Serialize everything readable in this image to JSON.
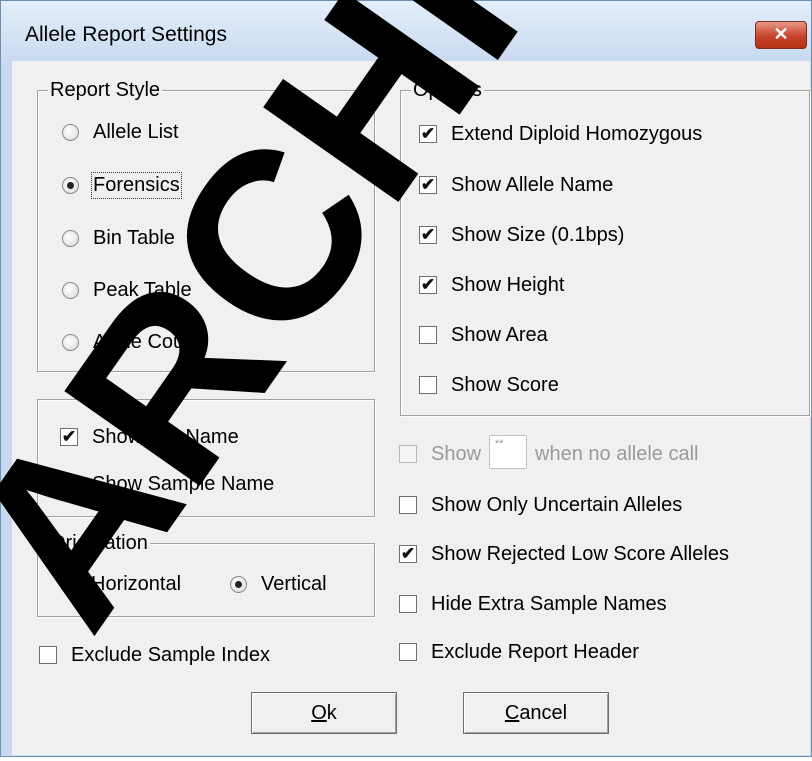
{
  "title": "Allele Report Settings",
  "close_glyph": "✕",
  "report_style": {
    "legend": "Report Style",
    "options": [
      {
        "label": "Allele List",
        "selected": false
      },
      {
        "label": "Forensics",
        "selected": true
      },
      {
        "label": "Bin Table",
        "selected": false
      },
      {
        "label": "Peak Table",
        "selected": false
      },
      {
        "label": "Allele Count",
        "selected": false
      }
    ]
  },
  "options_group": {
    "legend": "Options",
    "items": [
      {
        "label": "Extend Diploid Homozygous",
        "checked": true
      },
      {
        "label": "Show Allele Name",
        "checked": true
      },
      {
        "label": "Show Size (0.1bps)",
        "checked": true
      },
      {
        "label": "Show Height",
        "checked": true
      },
      {
        "label": "Show Area",
        "checked": false
      },
      {
        "label": "Show Score",
        "checked": false
      }
    ]
  },
  "names_group": {
    "items": [
      {
        "label": "Show File Name",
        "checked": true
      },
      {
        "label": "Show Sample Name",
        "checked": false
      }
    ]
  },
  "orientation": {
    "legend": "Orientation",
    "horizontal": "Horizontal",
    "vertical": "Vertical",
    "selected": "Vertical"
  },
  "exclude_sample_index": {
    "label": "Exclude Sample Index",
    "checked": false
  },
  "no_call": {
    "show_label": "Show",
    "placeholder_value": "**",
    "suffix": "when no allele call",
    "enabled": false,
    "checked": false
  },
  "right_checks": [
    {
      "label": "Show Only Uncertain Alleles",
      "checked": false
    },
    {
      "label": "Show Rejected Low Score Alleles",
      "checked": true
    },
    {
      "label": "Hide Extra Sample Names",
      "checked": false
    },
    {
      "label": "Exclude Report Header",
      "checked": false
    }
  ],
  "buttons": {
    "ok_mnemonic": "O",
    "ok_rest": "k",
    "cancel_mnemonic": "C",
    "cancel_rest": "ancel"
  },
  "watermark": "ARCHIVE",
  "colors": {
    "watermark": "#000000",
    "title_bar": "#c9daf0",
    "close_button": "#c7432a"
  }
}
